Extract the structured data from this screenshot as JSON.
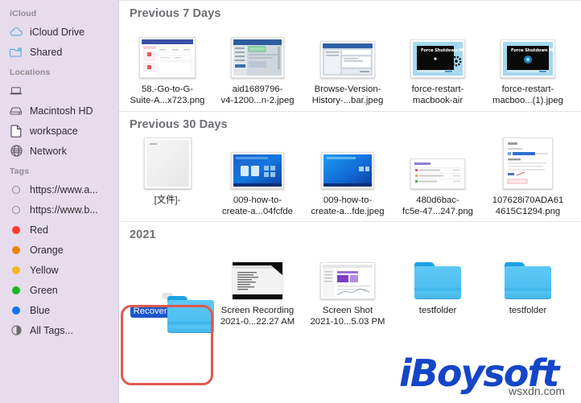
{
  "sidebar": {
    "sections": [
      {
        "header": "iCloud",
        "items": [
          {
            "label": "iCloud Drive",
            "icon": "cloud-icon"
          },
          {
            "label": "Shared",
            "icon": "shared-folder-icon"
          }
        ]
      },
      {
        "header": "Locations",
        "items": [
          {
            "label": "",
            "icon": "laptop-icon"
          },
          {
            "label": "Macintosh HD",
            "icon": "harddisk-icon"
          },
          {
            "label": "workspace",
            "icon": "document-icon"
          },
          {
            "label": "Network",
            "icon": "globe-icon"
          }
        ]
      },
      {
        "header": "Tags",
        "items": [
          {
            "label": "https://www.a...",
            "icon": "tag-none-icon",
            "color": "none"
          },
          {
            "label": "https://www.b...",
            "icon": "tag-none-icon",
            "color": "none"
          },
          {
            "label": "Red",
            "icon": "tag-dot-icon",
            "color": "#fc3b2d"
          },
          {
            "label": "Orange",
            "icon": "tag-dot-icon",
            "color": "#e8840c"
          },
          {
            "label": "Yellow",
            "icon": "tag-dot-icon",
            "color": "#f2b824"
          },
          {
            "label": "Green",
            "icon": "tag-dot-icon",
            "color": "#1db525"
          },
          {
            "label": "Blue",
            "icon": "tag-dot-icon",
            "color": "#1272f0"
          },
          {
            "label": "All Tags...",
            "icon": "all-tags-icon",
            "color": "none"
          }
        ]
      }
    ]
  },
  "main": {
    "sections": [
      {
        "title": "Previous 7 Days",
        "items": [
          {
            "name": "58.-Go-to-G-\nSuite-A...x723.png",
            "kind": "screenshot-light",
            "selected": false
          },
          {
            "name": "aid1689796-\nv4-1200...n-2.jpeg",
            "kind": "screenshot-blue-ui",
            "selected": false
          },
          {
            "name": "Browse-Version-\nHistory-...bar.jpeg",
            "kind": "screenshot-window",
            "selected": false
          },
          {
            "name": "force-restart-\nmacbook-air",
            "kind": "macbook-dark-gear",
            "selected": false
          },
          {
            "name": "force-restart-\nmacboo...(1).jpeg",
            "kind": "macbook-dark-circle",
            "selected": false
          }
        ],
        "edge_fragment": "n"
      },
      {
        "title": "Previous 30 Days",
        "items": [
          {
            "name": "[文件]-",
            "kind": "blank-doc",
            "selected": false
          },
          {
            "name": "009-how-to-\ncreate-a...04fcfde",
            "kind": "windows-desktop-icons",
            "selected": false
          },
          {
            "name": "009-how-to-\ncreate-a...fde.jpeg",
            "kind": "windows-desktop-plain",
            "selected": false
          },
          {
            "name": "480d6bac-\nfc5e-47...247.png",
            "kind": "list-ui",
            "selected": false
          },
          {
            "name": "107628i70ADA61\n4615C1294.png",
            "kind": "storage-panel",
            "selected": false
          }
        ],
        "edge_fragment": "a"
      },
      {
        "title": "2021",
        "items": [
          {
            "name": "Recovered items",
            "kind": "folder",
            "selected": true
          },
          {
            "name": "Screen Recording\n2021-0...22.27 AM",
            "kind": "screen-recording",
            "selected": false
          },
          {
            "name": "Screen Shot\n2021-10...5.03 PM",
            "kind": "screen-shot",
            "selected": false
          },
          {
            "name": "testfolder",
            "kind": "folder",
            "selected": false
          },
          {
            "name": "testfolder",
            "kind": "folder",
            "selected": false
          }
        ],
        "edge_fragment": ""
      }
    ]
  },
  "annotation": {
    "highlight_color": "#e05a4e",
    "target": "Recovered items"
  },
  "watermark": {
    "brand": "iBoysoft",
    "site": "wsxdn.com"
  }
}
